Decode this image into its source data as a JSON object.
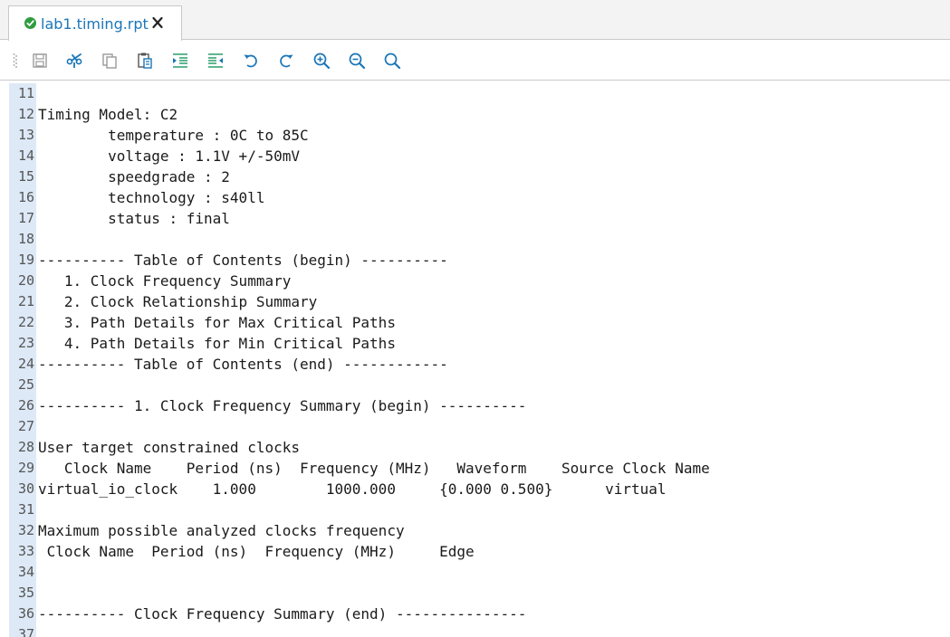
{
  "tab": {
    "title": "lab1.timing.rpt",
    "status_icon": "check-circle-icon",
    "close_icon": "close-icon",
    "status_color": "#2e9d3f",
    "title_color": "#1a76b8"
  },
  "toolbar": {
    "buttons": [
      {
        "name": "save-icon"
      },
      {
        "name": "cut-icon"
      },
      {
        "name": "copy-icon"
      },
      {
        "name": "paste-icon"
      },
      {
        "name": "indent-icon"
      },
      {
        "name": "outdent-icon"
      },
      {
        "name": "undo-icon"
      },
      {
        "name": "redo-icon"
      },
      {
        "name": "zoom-in-icon"
      },
      {
        "name": "zoom-out-icon"
      },
      {
        "name": "search-icon"
      }
    ],
    "icon_color": "#1a76b8"
  },
  "editor": {
    "gutter_color": "#dde9f6",
    "lines": [
      {
        "n": "11",
        "text": ""
      },
      {
        "n": "12",
        "text": "Timing Model: C2"
      },
      {
        "n": "13",
        "text": "        temperature : 0C to 85C"
      },
      {
        "n": "14",
        "text": "        voltage : 1.1V +/-50mV"
      },
      {
        "n": "15",
        "text": "        speedgrade : 2"
      },
      {
        "n": "16",
        "text": "        technology : s40ll"
      },
      {
        "n": "17",
        "text": "        status : final"
      },
      {
        "n": "18",
        "text": ""
      },
      {
        "n": "19",
        "text": "---------- Table of Contents (begin) ----------"
      },
      {
        "n": "20",
        "text": "   1. Clock Frequency Summary"
      },
      {
        "n": "21",
        "text": "   2. Clock Relationship Summary"
      },
      {
        "n": "22",
        "text": "   3. Path Details for Max Critical Paths"
      },
      {
        "n": "23",
        "text": "   4. Path Details for Min Critical Paths"
      },
      {
        "n": "24",
        "text": "---------- Table of Contents (end) ------------"
      },
      {
        "n": "25",
        "text": ""
      },
      {
        "n": "26",
        "text": "---------- 1. Clock Frequency Summary (begin) ----------"
      },
      {
        "n": "27",
        "text": ""
      },
      {
        "n": "28",
        "text": "User target constrained clocks"
      },
      {
        "n": "29",
        "text": "   Clock Name    Period (ns)  Frequency (MHz)   Waveform    Source Clock Name"
      },
      {
        "n": "30",
        "text": "virtual_io_clock    1.000        1000.000     {0.000 0.500}      virtual"
      },
      {
        "n": "31",
        "text": ""
      },
      {
        "n": "32",
        "text": "Maximum possible analyzed clocks frequency"
      },
      {
        "n": "33",
        "text": " Clock Name  Period (ns)  Frequency (MHz)     Edge"
      },
      {
        "n": "34",
        "text": ""
      },
      {
        "n": "35",
        "text": ""
      },
      {
        "n": "36",
        "text": "---------- Clock Frequency Summary (end) ---------------"
      },
      {
        "n": "37",
        "text": ""
      }
    ]
  }
}
